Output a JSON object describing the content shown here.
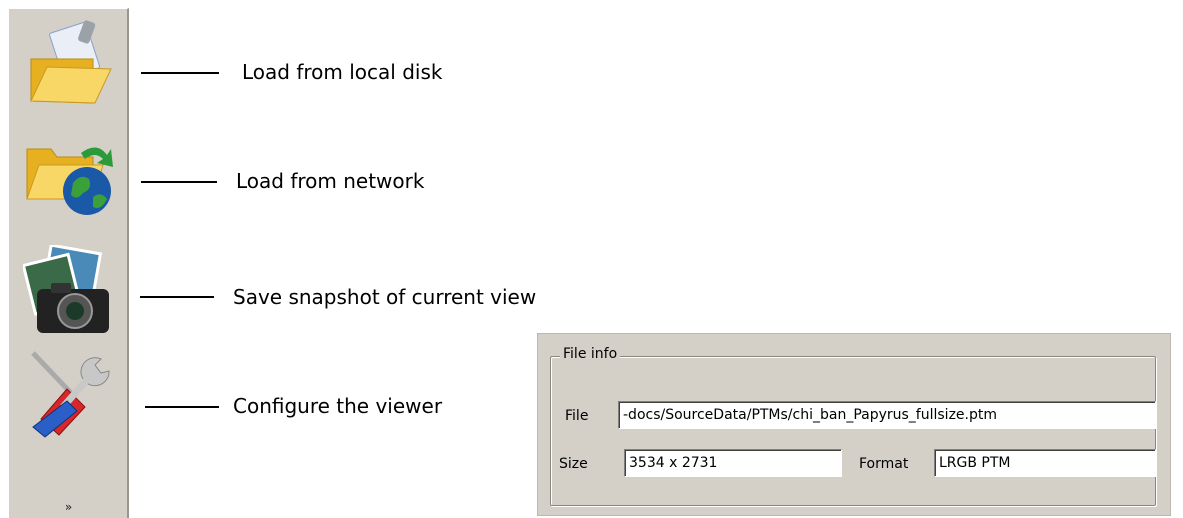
{
  "toolbar": {
    "items": [
      {
        "label": "Load from local disk",
        "icon": "open-folder-icon"
      },
      {
        "label": "Load from network",
        "icon": "network-folder-icon"
      },
      {
        "label": "Save snapshot of current view",
        "icon": "camera-icon"
      },
      {
        "label": "Configure the viewer",
        "icon": "tools-icon"
      }
    ],
    "overflow_glyph": "»"
  },
  "file_info": {
    "title": "File info",
    "file_label": "File",
    "file_value": "-docs/SourceData/PTMs/chi_ban_Papyrus_fullsize.ptm",
    "size_label": "Size",
    "size_value": "3534 x 2731",
    "format_label": "Format",
    "format_value": "LRGB PTM"
  },
  "colors": {
    "toolbar_bg": "#d4d0c8",
    "folder_yellow": "#f5c842",
    "screwdriver_red": "#d8262a",
    "wrench_blue": "#2a5fc8"
  }
}
